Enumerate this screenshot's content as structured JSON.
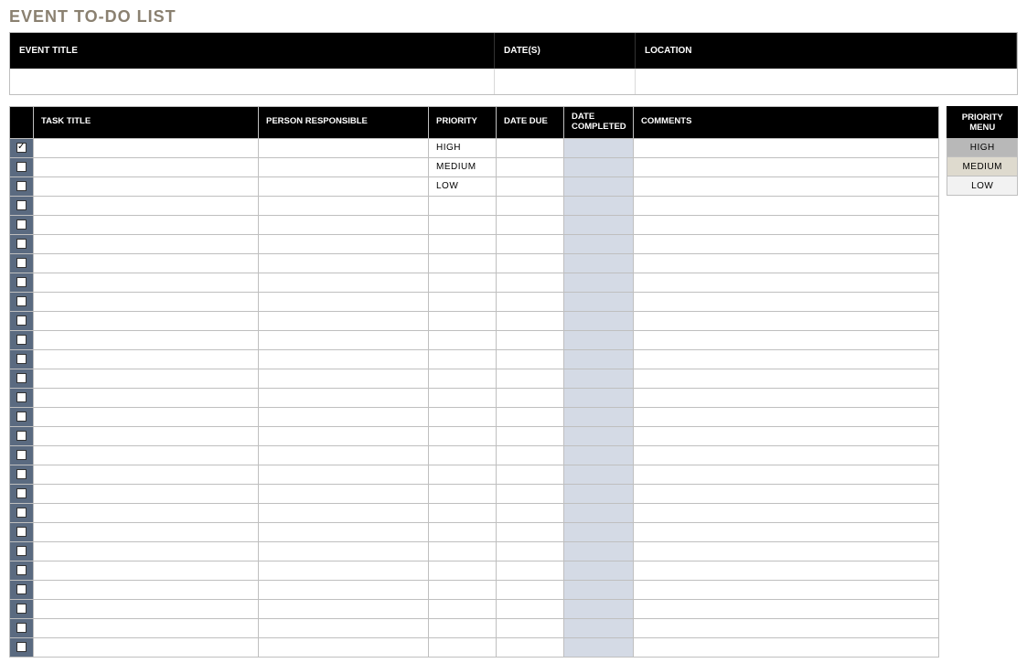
{
  "title": "EVENT TO-DO LIST",
  "event_info": {
    "headers": {
      "title": "EVENT TITLE",
      "dates": "DATE(S)",
      "location": "LOCATION"
    },
    "values": {
      "title": "",
      "dates": "",
      "location": ""
    }
  },
  "task_table": {
    "headers": {
      "task": "TASK TITLE",
      "person": "PERSON RESPONSIBLE",
      "priority": "PRIORITY",
      "date_due": "DATE DUE",
      "date_completed": "DATE COMPLETED",
      "comments": "COMMENTS"
    },
    "rows": [
      {
        "checked": true,
        "task": "",
        "person": "",
        "priority": "HIGH",
        "date_due": "",
        "date_completed": "",
        "comments": ""
      },
      {
        "checked": false,
        "task": "",
        "person": "",
        "priority": "MEDIUM",
        "date_due": "",
        "date_completed": "",
        "comments": ""
      },
      {
        "checked": false,
        "task": "",
        "person": "",
        "priority": "LOW",
        "date_due": "",
        "date_completed": "",
        "comments": ""
      },
      {
        "checked": false,
        "task": "",
        "person": "",
        "priority": "",
        "date_due": "",
        "date_completed": "",
        "comments": ""
      },
      {
        "checked": false,
        "task": "",
        "person": "",
        "priority": "",
        "date_due": "",
        "date_completed": "",
        "comments": ""
      },
      {
        "checked": false,
        "task": "",
        "person": "",
        "priority": "",
        "date_due": "",
        "date_completed": "",
        "comments": ""
      },
      {
        "checked": false,
        "task": "",
        "person": "",
        "priority": "",
        "date_due": "",
        "date_completed": "",
        "comments": ""
      },
      {
        "checked": false,
        "task": "",
        "person": "",
        "priority": "",
        "date_due": "",
        "date_completed": "",
        "comments": ""
      },
      {
        "checked": false,
        "task": "",
        "person": "",
        "priority": "",
        "date_due": "",
        "date_completed": "",
        "comments": ""
      },
      {
        "checked": false,
        "task": "",
        "person": "",
        "priority": "",
        "date_due": "",
        "date_completed": "",
        "comments": ""
      },
      {
        "checked": false,
        "task": "",
        "person": "",
        "priority": "",
        "date_due": "",
        "date_completed": "",
        "comments": ""
      },
      {
        "checked": false,
        "task": "",
        "person": "",
        "priority": "",
        "date_due": "",
        "date_completed": "",
        "comments": ""
      },
      {
        "checked": false,
        "task": "",
        "person": "",
        "priority": "",
        "date_due": "",
        "date_completed": "",
        "comments": ""
      },
      {
        "checked": false,
        "task": "",
        "person": "",
        "priority": "",
        "date_due": "",
        "date_completed": "",
        "comments": ""
      },
      {
        "checked": false,
        "task": "",
        "person": "",
        "priority": "",
        "date_due": "",
        "date_completed": "",
        "comments": ""
      },
      {
        "checked": false,
        "task": "",
        "person": "",
        "priority": "",
        "date_due": "",
        "date_completed": "",
        "comments": ""
      },
      {
        "checked": false,
        "task": "",
        "person": "",
        "priority": "",
        "date_due": "",
        "date_completed": "",
        "comments": ""
      },
      {
        "checked": false,
        "task": "",
        "person": "",
        "priority": "",
        "date_due": "",
        "date_completed": "",
        "comments": ""
      },
      {
        "checked": false,
        "task": "",
        "person": "",
        "priority": "",
        "date_due": "",
        "date_completed": "",
        "comments": ""
      },
      {
        "checked": false,
        "task": "",
        "person": "",
        "priority": "",
        "date_due": "",
        "date_completed": "",
        "comments": ""
      },
      {
        "checked": false,
        "task": "",
        "person": "",
        "priority": "",
        "date_due": "",
        "date_completed": "",
        "comments": ""
      },
      {
        "checked": false,
        "task": "",
        "person": "",
        "priority": "",
        "date_due": "",
        "date_completed": "",
        "comments": ""
      },
      {
        "checked": false,
        "task": "",
        "person": "",
        "priority": "",
        "date_due": "",
        "date_completed": "",
        "comments": ""
      },
      {
        "checked": false,
        "task": "",
        "person": "",
        "priority": "",
        "date_due": "",
        "date_completed": "",
        "comments": ""
      },
      {
        "checked": false,
        "task": "",
        "person": "",
        "priority": "",
        "date_due": "",
        "date_completed": "",
        "comments": ""
      },
      {
        "checked": false,
        "task": "",
        "person": "",
        "priority": "",
        "date_due": "",
        "date_completed": "",
        "comments": ""
      },
      {
        "checked": false,
        "task": "",
        "person": "",
        "priority": "",
        "date_due": "",
        "date_completed": "",
        "comments": ""
      }
    ]
  },
  "priority_menu": {
    "header": "PRIORITY MENU",
    "items": [
      {
        "label": "HIGH",
        "class": "prio-high"
      },
      {
        "label": "MEDIUM",
        "class": "prio-medium"
      },
      {
        "label": "LOW",
        "class": "prio-low"
      }
    ]
  },
  "priority_colors": {
    "HIGH": "prio-high",
    "MEDIUM": "prio-medium",
    "LOW": "prio-low"
  }
}
